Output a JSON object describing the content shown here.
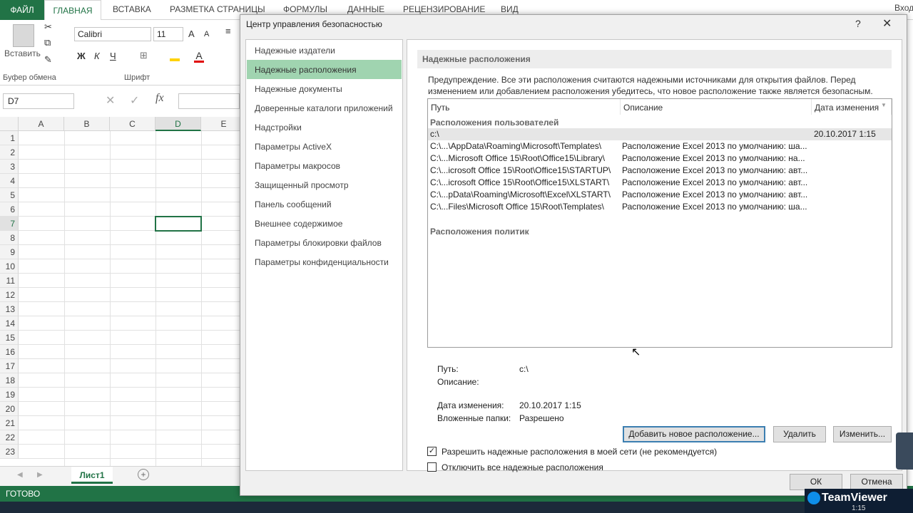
{
  "ribbon_tabs": [
    "ФАЙЛ",
    "ГЛАВНАЯ",
    "ВСТАВКА",
    "РАЗМЕТКА СТРАНИЦЫ",
    "ФОРМУЛЫ",
    "ДАННЫЕ",
    "РЕЦЕНЗИРОВАНИЕ",
    "ВИД"
  ],
  "sign_in": "Вход",
  "ribbon": {
    "paste_label": "Вставить",
    "clipboard_group": "Буфер обмена",
    "font_group": "Шрифт",
    "font_name": "Calibri",
    "font_size": "11",
    "bold": "Ж",
    "italic": "К",
    "underline": "Ч"
  },
  "formula_bar": {
    "name_box": "D7",
    "fx": "fx"
  },
  "sheet": {
    "columns": [
      "A",
      "B",
      "C",
      "D",
      "E"
    ],
    "rows": [
      "1",
      "2",
      "3",
      "4",
      "5",
      "6",
      "7",
      "8",
      "9",
      "10",
      "11",
      "12",
      "13",
      "14",
      "15",
      "16",
      "17",
      "18",
      "19",
      "20",
      "21",
      "22",
      "23"
    ],
    "tab": "Лист1",
    "add_sheet": "+"
  },
  "status": {
    "ready": "ГОТОВО"
  },
  "dialog": {
    "title": "Центр управления безопасностью",
    "help": "?",
    "close": "✕",
    "nav_items": [
      "Надежные издатели",
      "Надежные расположения",
      "Надежные документы",
      "Доверенные каталоги приложений",
      "Надстройки",
      "Параметры ActiveX",
      "Параметры макросов",
      "Защищенный просмотр",
      "Панель сообщений",
      "Внешнее содержимое",
      "Параметры блокировки файлов",
      "Параметры конфиденциальности"
    ],
    "selected_nav": 1,
    "section_title": "Надежные расположения",
    "warning": "Предупреждение. Все эти расположения считаются надежными источниками для открытия файлов. Перед изменением или добавлением расположения убедитесь, что новое расположение также является безопасным.",
    "list": {
      "col_path": "Путь",
      "col_desc": "Описание",
      "col_date": "Дата изменения",
      "user_group": "Расположения пользователей",
      "policy_group": "Расположения политик",
      "rows": [
        {
          "path": "c:\\",
          "desc": "",
          "date": "20.10.2017 1:15"
        },
        {
          "path": "C:\\...\\AppData\\Roaming\\Microsoft\\Templates\\",
          "desc": "Расположение Excel 2013 по умолчанию: ша...",
          "date": ""
        },
        {
          "path": "C:\\...Microsoft Office 15\\Root\\Office15\\Library\\",
          "desc": "Расположение Excel 2013 по умолчанию: на...",
          "date": ""
        },
        {
          "path": "C:\\...icrosoft Office 15\\Root\\Office15\\STARTUP\\",
          "desc": "Расположение Excel 2013 по умолчанию: авт...",
          "date": ""
        },
        {
          "path": "C:\\...icrosoft Office 15\\Root\\Office15\\XLSTART\\",
          "desc": "Расположение Excel 2013 по умолчанию: авт...",
          "date": ""
        },
        {
          "path": "C:\\...pData\\Roaming\\Microsoft\\Excel\\XLSTART\\",
          "desc": "Расположение Excel 2013 по умолчанию: авт...",
          "date": ""
        },
        {
          "path": "C:\\...Files\\Microsoft Office 15\\Root\\Templates\\",
          "desc": "Расположение Excel 2013 по умолчанию: ша...",
          "date": ""
        }
      ]
    },
    "details": {
      "path_label": "Путь:",
      "path_value": "c:\\",
      "desc_label": "Описание:",
      "date_label": "Дата изменения:",
      "date_value": "20.10.2017 1:15",
      "subfolders_label": "Вложенные папки:",
      "subfolders_value": "Разрешено"
    },
    "buttons": {
      "add": "Добавить новое расположение...",
      "remove": "Удалить",
      "modify": "Изменить...",
      "ok": "ОК",
      "cancel": "Отмена"
    },
    "checkboxes": {
      "network": {
        "label": "Разрешить надежные расположения в моей сети (не рекомендуется)",
        "checked": true
      },
      "disable_all": {
        "label": "Отключить все надежные расположения",
        "checked": false
      }
    }
  },
  "teamviewer": {
    "brand": "TeamViewer",
    "time": "1:15"
  },
  "colors": {
    "excel_green": "#217346",
    "nav_selected": "#a0d4b0"
  }
}
